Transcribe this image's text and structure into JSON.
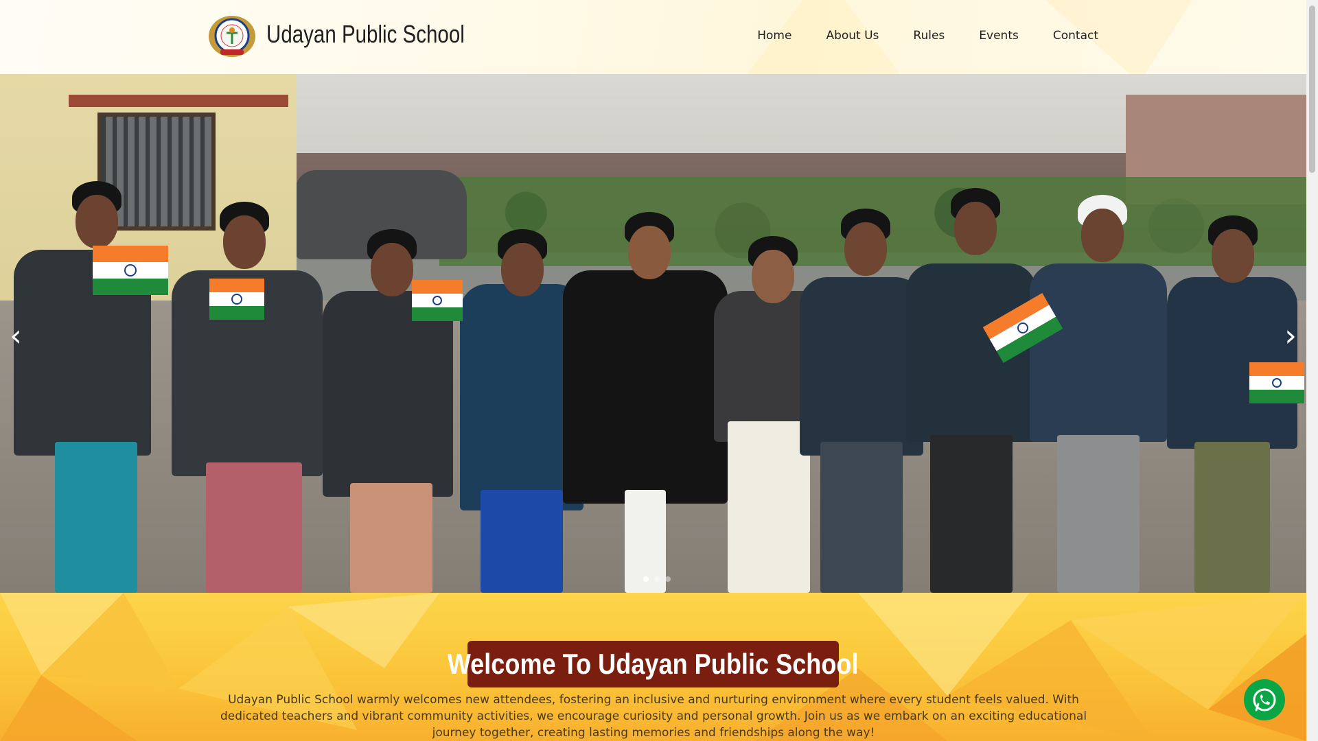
{
  "header": {
    "brand": "Udayan Public School",
    "logo_icon": "school-crest-icon"
  },
  "nav": {
    "items": [
      {
        "label": "Home"
      },
      {
        "label": "About Us"
      },
      {
        "label": "Rules"
      },
      {
        "label": "Events"
      },
      {
        "label": "Contact"
      }
    ]
  },
  "slider": {
    "prev_icon": "chevron-left-icon",
    "next_icon": "chevron-right-icon",
    "prev_glyph": "‹",
    "next_glyph": "›",
    "slide_count": 3,
    "active_slide": 1
  },
  "welcome": {
    "title": "Welcome To Udayan Public School",
    "text": "Udayan Public School warmly welcomes new attendees, fostering an inclusive and nurturing environment where every student feels valued. With dedicated teachers and vibrant community activities, we encourage curiosity and personal growth. Join us as we embark on an exciting educational journey together, creating lasting memories and friendships along the way!"
  },
  "floating": {
    "whatsapp_icon": "whatsapp-icon"
  },
  "colors": {
    "title_box": "#7a1f0f",
    "section_yellow": "#fbc53a",
    "whatsapp_green": "#0aa545"
  }
}
